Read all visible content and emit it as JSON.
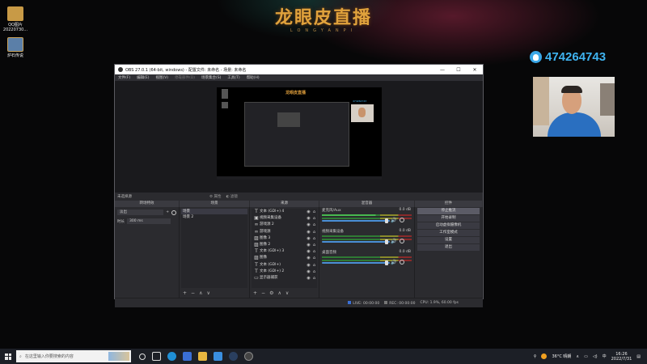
{
  "desktop": {
    "icons": [
      {
        "label": "QQ图片20220730..."
      },
      {
        "label": "炉石传说"
      }
    ],
    "brand": {
      "title": "龙眼皮直播",
      "subtitle": "LONGYANPI"
    },
    "qq_number": "474264743"
  },
  "obs": {
    "window_title": "OBS 27.0.1 (64-bit, windows) - 配置文件: 未命名 - 场景: 未命名",
    "menu": [
      "文件(F)",
      "编辑(E)",
      "视图(V)",
      "停靠部件(D)",
      "场景集合(S)",
      "工具(T)",
      "帮助(H)"
    ],
    "scene_label": "未选择源",
    "props_btn": "属性",
    "filter_btn": "滤镜",
    "docks": {
      "transitions": "转场特效",
      "scenes": "场景",
      "sources": "来源",
      "mixer": "混音器",
      "controls": "控件"
    },
    "transition": {
      "type": "淡出",
      "duration_label": "时长",
      "duration": "300 ms"
    },
    "scenes": [
      "场景",
      "场景 2"
    ],
    "sources": [
      {
        "icon": "text-icon",
        "name": "文本 (GDI+) 4"
      },
      {
        "icon": "video-device-icon",
        "name": "视频采集设备"
      },
      {
        "icon": "link-icon",
        "name": "游戏源 2"
      },
      {
        "icon": "link-icon",
        "name": "游戏源"
      },
      {
        "icon": "image-icon",
        "name": "图像 3"
      },
      {
        "icon": "image-icon",
        "name": "图像 2"
      },
      {
        "icon": "text-icon",
        "name": "文本 (GDI+) 3"
      },
      {
        "icon": "image-icon",
        "name": "图像"
      },
      {
        "icon": "text-icon",
        "name": "文本 (GDI+)"
      },
      {
        "icon": "text-icon",
        "name": "文本 (GDI+) 2"
      },
      {
        "icon": "monitor-icon",
        "name": "显示器捕获"
      }
    ],
    "mixer": [
      {
        "name": "麦克风/Aux",
        "db": "0.0 dB",
        "level": 0.6
      },
      {
        "name": "视频采集设备",
        "db": "0.0 dB",
        "level": 0.0
      },
      {
        "name": "桌面音频",
        "db": "0.0 dB",
        "level": 0.0
      }
    ],
    "controls": [
      "停止推流",
      "开始录制",
      "启动虚拟摄像机",
      "工作室模式",
      "设置",
      "退出"
    ],
    "status": {
      "live_label": "LIVE:",
      "live_time": "00:00:00",
      "rec_label": "REC:",
      "rec_time": "00:00:00",
      "cpu": "CPU: 1.9%, 60.00 fps"
    }
  },
  "taskbar": {
    "search_placeholder": "在这里输入你要搜索的内容",
    "weather": "36°C 晴朗",
    "ime": "中",
    "time": "16:26",
    "date": "2022/7/31"
  }
}
